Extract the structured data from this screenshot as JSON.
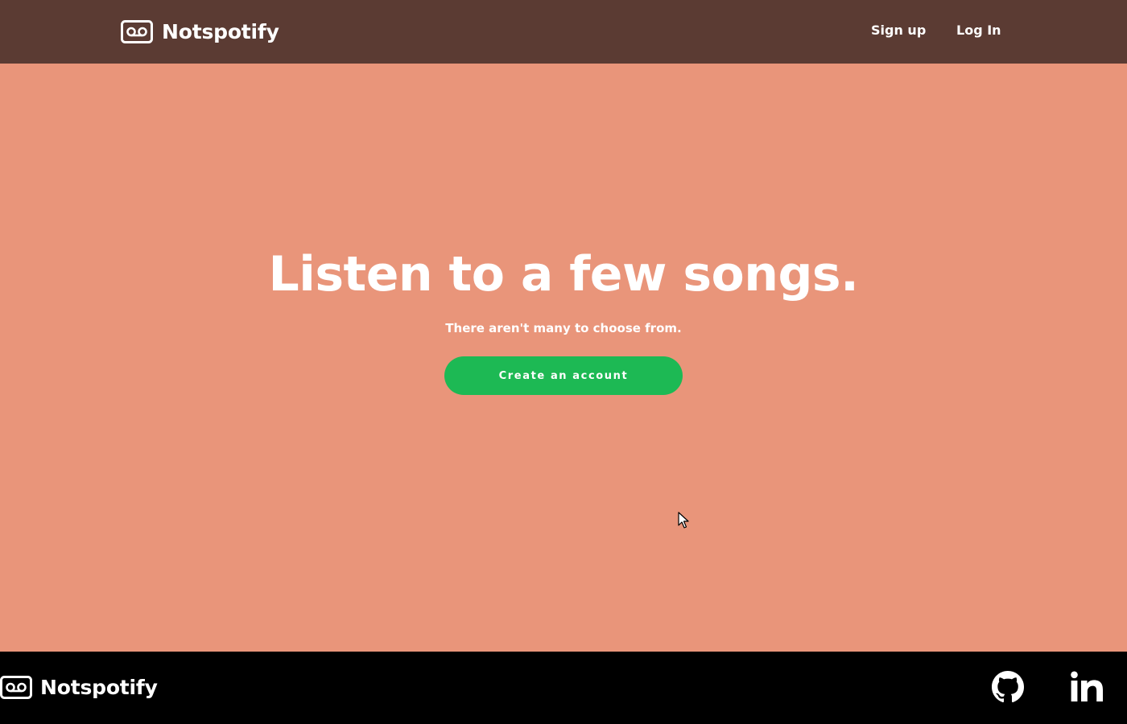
{
  "header": {
    "brand_name": "Notspotify",
    "brand_icon": "voicemail-icon",
    "nav": {
      "signup_label": "Sign up",
      "login_label": "Log In"
    }
  },
  "hero": {
    "title": "Listen to a few songs.",
    "subtitle": "There aren't many to choose from.",
    "cta_label": "Create an account"
  },
  "footer": {
    "brand_name": "Notspotify",
    "brand_icon": "voicemail-icon",
    "social_icons": [
      "github-icon",
      "linkedin-icon"
    ]
  },
  "colors": {
    "header_bg": "#5b3b33",
    "page_bg": "#e9957a",
    "cta_bg": "#1db954",
    "footer_bg": "#000000",
    "text": "#ffffff"
  }
}
